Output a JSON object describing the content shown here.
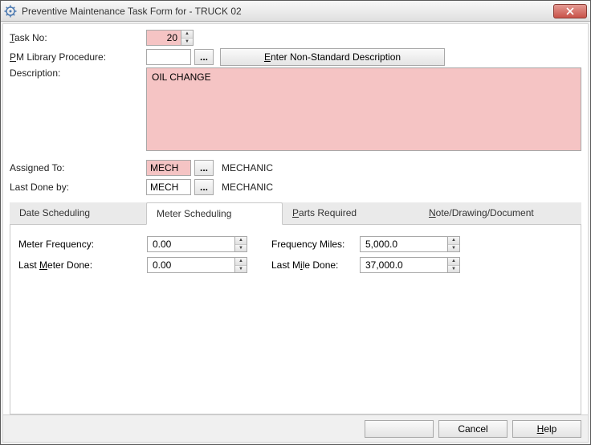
{
  "window": {
    "title": "Preventive Maintenance Task Form for - TRUCK 02"
  },
  "form": {
    "task_no_label_pre": "T",
    "task_no_label_post": "ask No:",
    "task_no_value": "20",
    "pm_lib_label_pre": "P",
    "pm_lib_label_post": "M Library Procedure:",
    "pm_lib_value": "",
    "non_std_btn_pre": "E",
    "non_std_btn_post": "nter Non-Standard Description",
    "description_label": "Description:",
    "description_value": "OIL CHANGE",
    "assigned_to_label": "Assigned To:",
    "assigned_to_code": "MECH",
    "assigned_to_role": "MECHANIC",
    "last_done_by_label": "Last Done by:",
    "last_done_by_code": "MECH",
    "last_done_by_role": "MECHANIC",
    "ellipsis": "..."
  },
  "tabs": {
    "date_scheduling": "Date Scheduling",
    "meter_scheduling": "Meter Scheduling",
    "parts_pre": "P",
    "parts_post": "arts Required",
    "note_pre": "N",
    "note_post": "ote/Drawing/Document"
  },
  "meter_panel": {
    "meter_freq_label": "Meter Frequency:",
    "meter_freq_value": "0.00",
    "last_meter_label_pre": "Last ",
    "last_meter_label_u": "M",
    "last_meter_label_post": "eter Done:",
    "last_meter_value": "0.00",
    "freq_miles_label": "Frequency Miles:",
    "freq_miles_value": "5,000.0",
    "last_mile_label_pre": "Last M",
    "last_mile_label_u": "i",
    "last_mile_label_post": "le Done:",
    "last_mile_value": "37,000.0"
  },
  "footer": {
    "blank": "",
    "cancel": "Cancel",
    "help_u": "H",
    "help_post": "elp"
  }
}
